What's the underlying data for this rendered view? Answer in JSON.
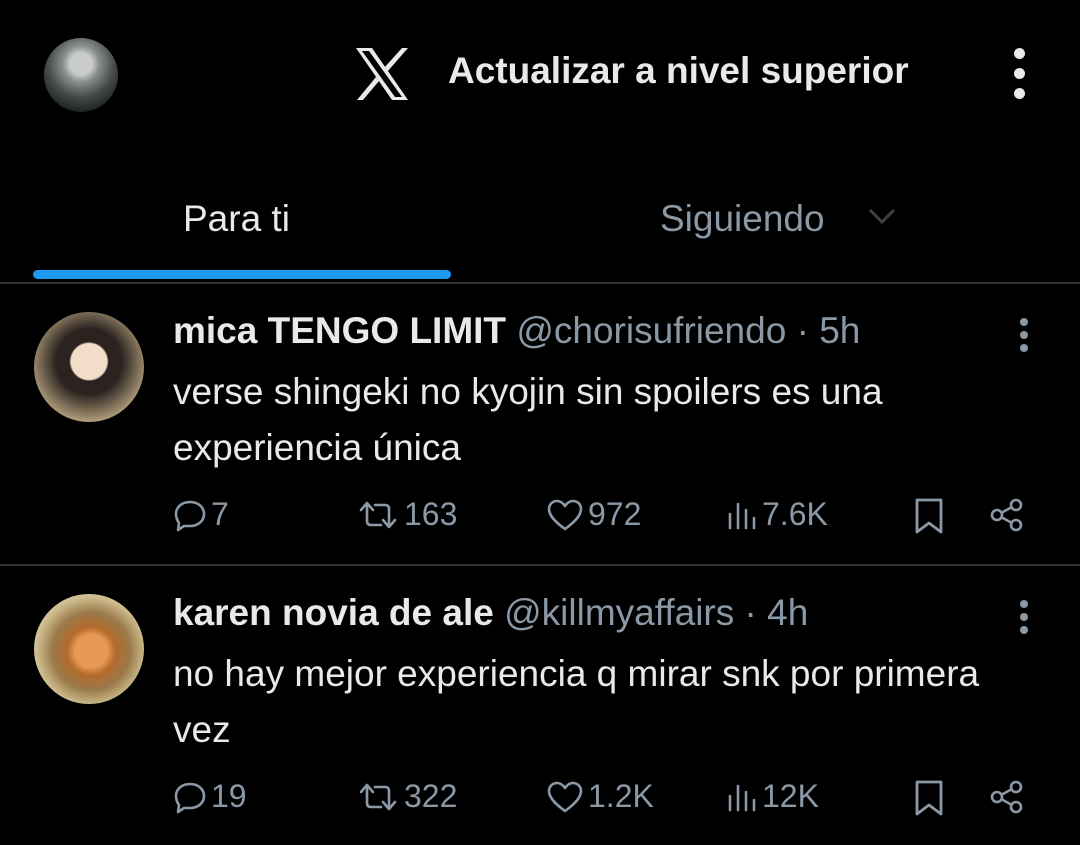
{
  "header": {
    "upgrade_label": "Actualizar a nivel superior"
  },
  "tabs": [
    {
      "label": "Para ti",
      "active": true
    },
    {
      "label": "Siguiendo",
      "active": false
    }
  ],
  "colors": {
    "accent": "#1d9bf0",
    "text": "#e7e9ea",
    "muted": "#8b98a5",
    "background": "#000000"
  },
  "tweets": [
    {
      "name": "mica TENGO LIMIT",
      "handle": "@chorisufriendo",
      "separator": "·",
      "time": "5h",
      "text": "verse shingeki no kyojin sin spoilers es una experiencia única",
      "replies": "7",
      "retweets": "163",
      "likes": "972",
      "views": "7.6K"
    },
    {
      "name": "karen novia de ale",
      "handle": "@killmyaffairs",
      "separator": "·",
      "time": "4h",
      "text": "no hay mejor experiencia q mirar snk por primera vez",
      "replies": "19",
      "retweets": "322",
      "likes": "1.2K",
      "views": "12K"
    }
  ],
  "icons": [
    "avatar",
    "x-logo-icon",
    "more-vertical-icon",
    "chevron-down-icon",
    "reply-icon",
    "retweet-icon",
    "like-icon",
    "views-icon",
    "bookmark-icon",
    "share-icon"
  ]
}
